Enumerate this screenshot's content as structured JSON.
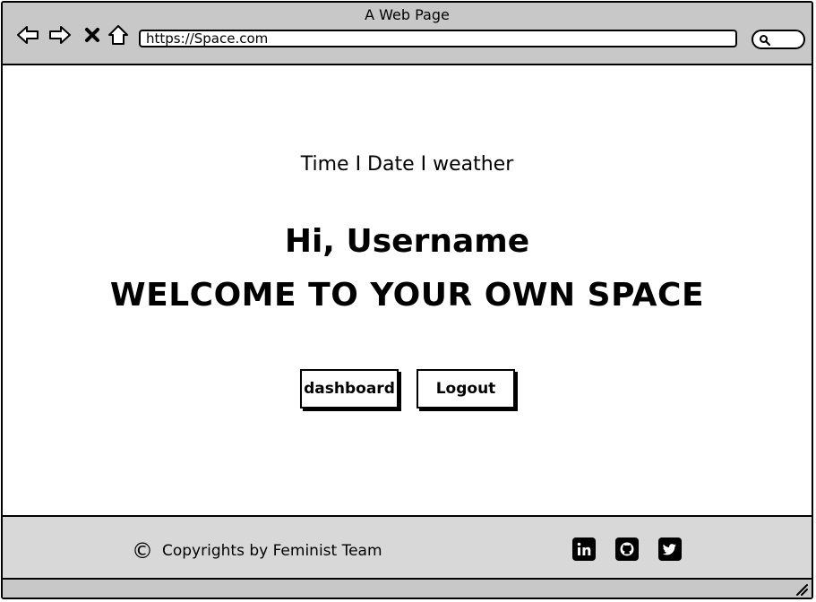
{
  "window": {
    "title": "A Web Page"
  },
  "browser": {
    "url": "https://Space.com",
    "icons": [
      "back-arrow-icon",
      "forward-arrow-icon",
      "close-icon",
      "home-icon",
      "search-icon"
    ]
  },
  "main": {
    "info_line": "Time I Date I weather",
    "greeting": "Hi, Username",
    "welcome": "WELCOME TO YOUR OWN SPACE",
    "buttons": {
      "dashboard": "dashboard",
      "logout": "Logout"
    }
  },
  "footer": {
    "copyright_symbol": "©",
    "copyright_text": "Copyrights by Feminist Team",
    "social_icons": [
      "linkedin-icon",
      "github-icon",
      "twitter-icon"
    ]
  },
  "colors": {
    "titlebar": "#c8c8c8",
    "footer": "#d8d8d8",
    "ink": "#000000",
    "page": "#ffffff"
  }
}
